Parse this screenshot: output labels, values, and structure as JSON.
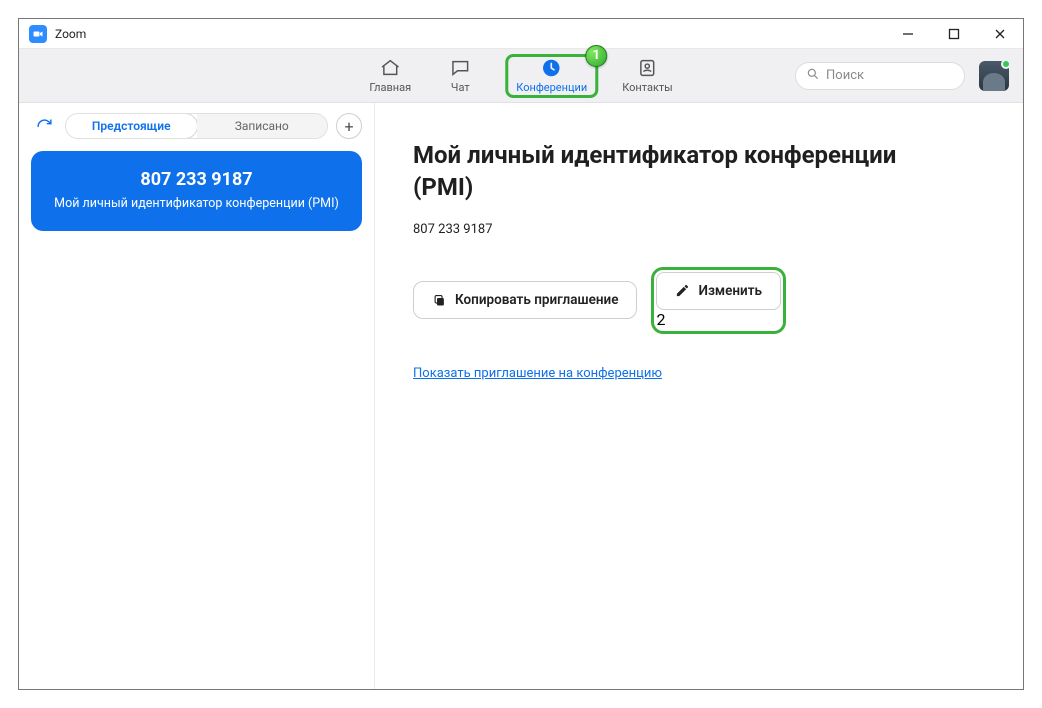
{
  "window": {
    "title": "Zoom"
  },
  "tabs": {
    "home": "Главная",
    "chat": "Чат",
    "meetings": "Конференции",
    "contacts": "Контакты"
  },
  "search": {
    "placeholder": "Поиск"
  },
  "sidebar": {
    "seg_upcoming": "Предстоящие",
    "seg_recorded": "Записано",
    "card_id": "807 233 9187",
    "card_sub": "Мой личный идентификатор конференции (PMI)"
  },
  "main": {
    "title": "Мой личный идентификатор конференции (PMI)",
    "meeting_id": "807 233 9187",
    "copy_btn": "Копировать приглашение",
    "edit_btn": "Изменить",
    "show_invite_link": "Показать приглашение на конференцию"
  },
  "annotations": {
    "tab_badge": "1",
    "edit_badge": "2"
  }
}
